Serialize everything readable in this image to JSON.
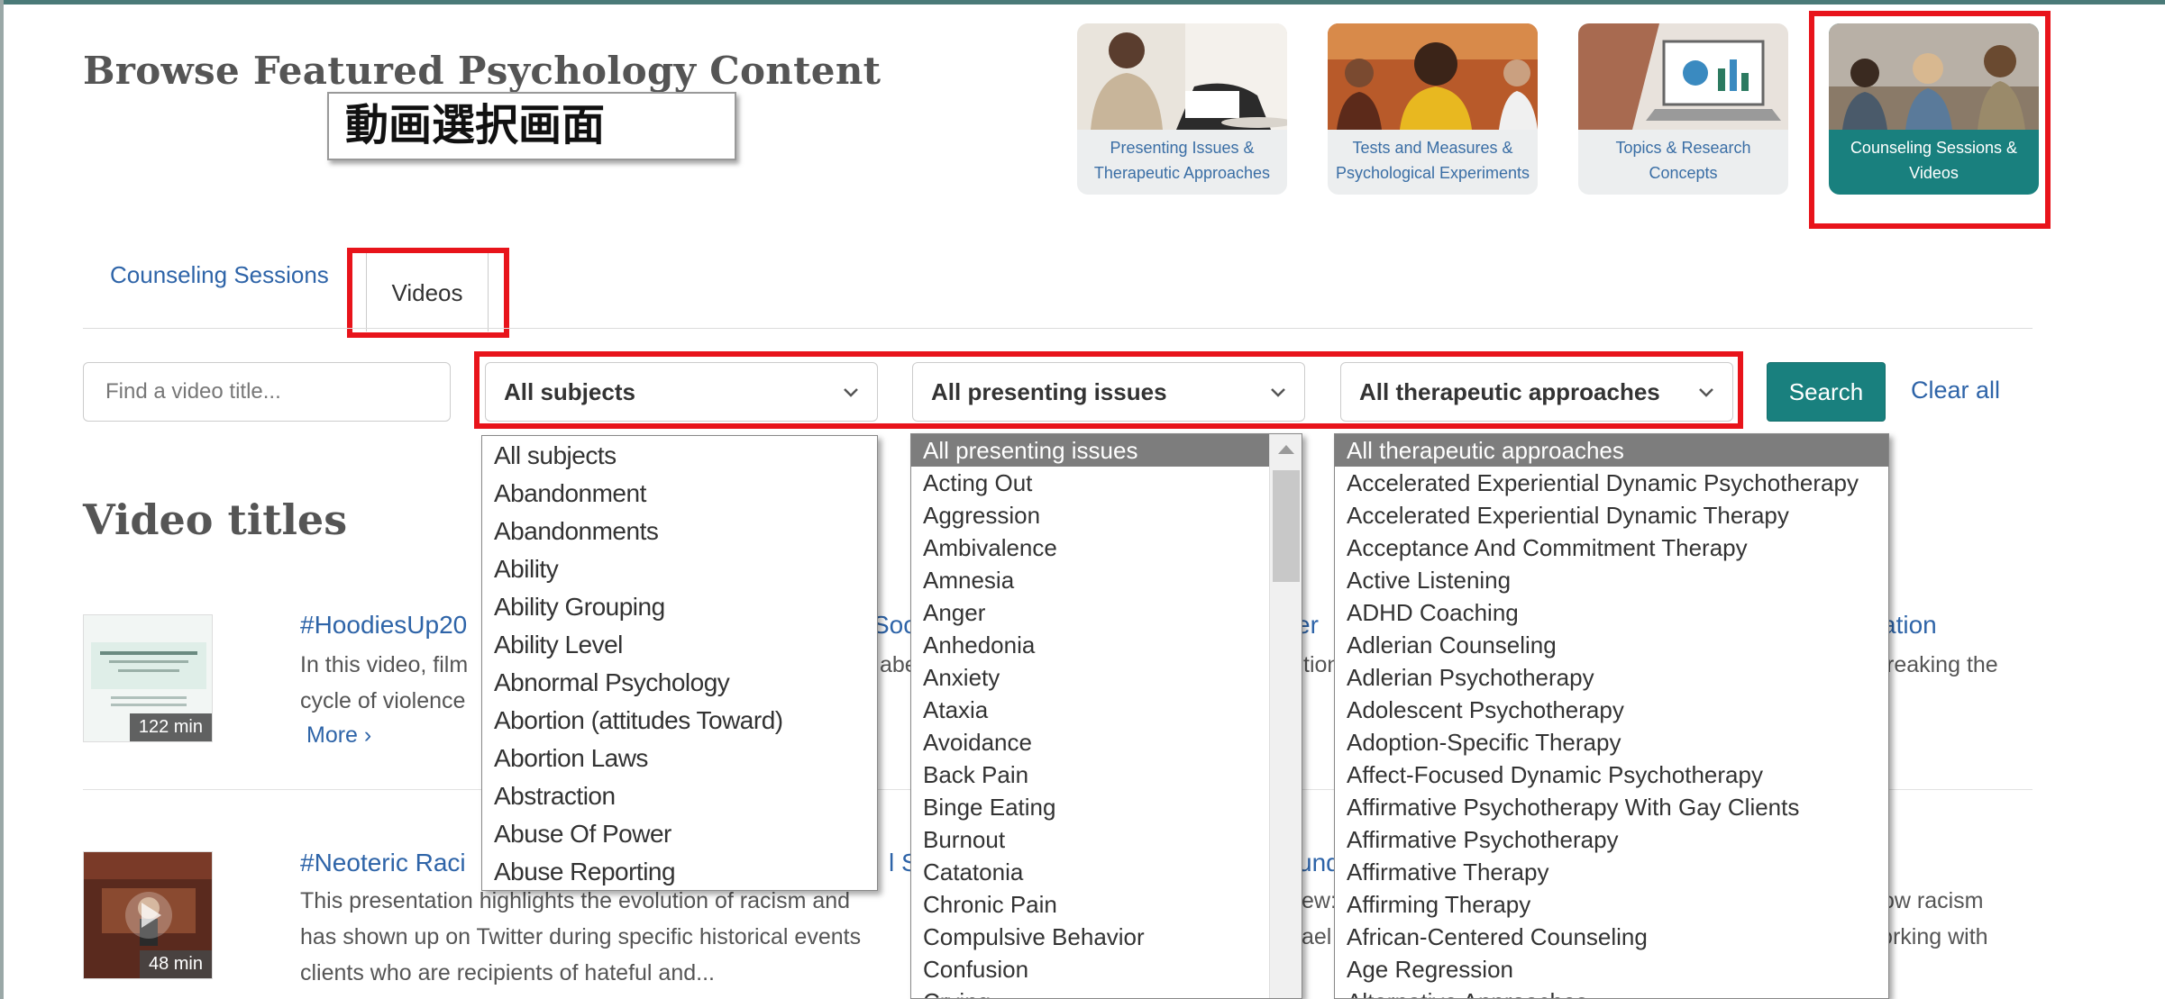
{
  "page": {
    "title": "Browse Featured Psychology Content",
    "annotation": "動画選択画面"
  },
  "categories": [
    {
      "label": "Presenting Issues & Therapeutic Approaches"
    },
    {
      "label": "Tests and Measures & Psychological Experiments"
    },
    {
      "label": "Topics & Research Concepts"
    },
    {
      "label": "Counseling Sessions & Videos"
    }
  ],
  "tabs": {
    "counseling": "Counseling Sessions",
    "videos": "Videos"
  },
  "filters": {
    "search_placeholder": "Find a video title...",
    "subjects": "All subjects",
    "presenting": "All presenting issues",
    "approaches": "All therapeutic approaches",
    "search_button": "Search",
    "clear_all": "Clear all"
  },
  "section_title": "Video titles",
  "videos": [
    {
      "title_left": "#HoodiesUp20",
      "title_mid": "Soc",
      "title_mid2": "er",
      "title_right": "ation",
      "desc1_left": "In this video, film",
      "desc1_mid": "abe",
      "desc1_mid2": "tion",
      "desc1_right": "reaking the",
      "desc2": "cycle of violence",
      "more": "More ›",
      "duration": "122 min"
    },
    {
      "title_left": "#Neoteric Raci",
      "title_mid": "l S",
      "title_mid2": "und",
      "desc1": "This presentation highlights the evolution of racism and",
      "desc1_mid2": "ew:",
      "desc1_right": "ow racism",
      "desc2": "has shown up on Twitter during specific historical events",
      "desc2_mid2": "ael",
      "desc2_right": "working with",
      "desc3": "clients who are recipients of hateful and...",
      "duration": "48 min"
    }
  ],
  "subjects_list": [
    "All subjects",
    "Abandonment",
    "Abandonments",
    "Ability",
    "Ability Grouping",
    "Ability Level",
    "Abnormal Psychology",
    "Abortion (attitudes Toward)",
    "Abortion Laws",
    "Abstraction",
    "Abuse Of Power",
    "Abuse Reporting"
  ],
  "issues_list": [
    "All presenting issues",
    "Acting Out",
    "Aggression",
    "Ambivalence",
    "Amnesia",
    "Anger",
    "Anhedonia",
    "Anxiety",
    "Ataxia",
    "Avoidance",
    "Back Pain",
    "Binge Eating",
    "Burnout",
    "Catatonia",
    "Chronic Pain",
    "Compulsive Behavior",
    "Confusion",
    "Crying"
  ],
  "approaches_list": [
    "All therapeutic approaches",
    "Accelerated Experiential Dynamic Psychotherapy",
    "Accelerated Experiential Dynamic Therapy",
    "Acceptance And Commitment Therapy",
    "Active Listening",
    "ADHD Coaching",
    "Adlerian Counseling",
    "Adlerian Psychotherapy",
    "Adolescent Psychotherapy",
    "Adoption-Specific Therapy",
    "Affect-Focused Dynamic Psychotherapy",
    "Affirmative Psychotherapy With Gay Clients",
    "Affirmative Psychotherapy",
    "Affirmative Therapy",
    "Affirming Therapy",
    "African-Centered Counseling",
    "Age Regression",
    "Alternative Approaches"
  ],
  "colors": {
    "teal": "#19807e",
    "link": "#2e64a8",
    "highlight": "#e8141b"
  }
}
